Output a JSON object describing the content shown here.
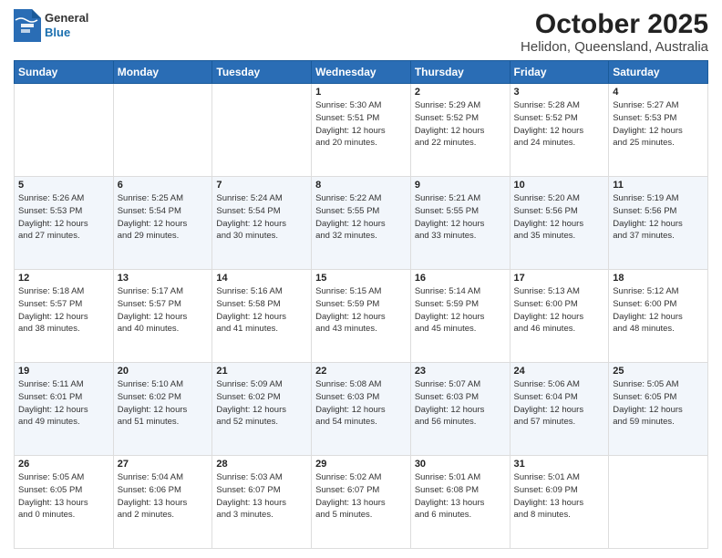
{
  "header": {
    "logo": {
      "line1": "General",
      "line2": "Blue"
    },
    "title": "October 2025",
    "subtitle": "Helidon, Queensland, Australia"
  },
  "calendar": {
    "days_of_week": [
      "Sunday",
      "Monday",
      "Tuesday",
      "Wednesday",
      "Thursday",
      "Friday",
      "Saturday"
    ],
    "weeks": [
      [
        {
          "day": "",
          "info": ""
        },
        {
          "day": "",
          "info": ""
        },
        {
          "day": "",
          "info": ""
        },
        {
          "day": "1",
          "info": "Sunrise: 5:30 AM\nSunset: 5:51 PM\nDaylight: 12 hours\nand 20 minutes."
        },
        {
          "day": "2",
          "info": "Sunrise: 5:29 AM\nSunset: 5:52 PM\nDaylight: 12 hours\nand 22 minutes."
        },
        {
          "day": "3",
          "info": "Sunrise: 5:28 AM\nSunset: 5:52 PM\nDaylight: 12 hours\nand 24 minutes."
        },
        {
          "day": "4",
          "info": "Sunrise: 5:27 AM\nSunset: 5:53 PM\nDaylight: 12 hours\nand 25 minutes."
        }
      ],
      [
        {
          "day": "5",
          "info": "Sunrise: 5:26 AM\nSunset: 5:53 PM\nDaylight: 12 hours\nand 27 minutes."
        },
        {
          "day": "6",
          "info": "Sunrise: 5:25 AM\nSunset: 5:54 PM\nDaylight: 12 hours\nand 29 minutes."
        },
        {
          "day": "7",
          "info": "Sunrise: 5:24 AM\nSunset: 5:54 PM\nDaylight: 12 hours\nand 30 minutes."
        },
        {
          "day": "8",
          "info": "Sunrise: 5:22 AM\nSunset: 5:55 PM\nDaylight: 12 hours\nand 32 minutes."
        },
        {
          "day": "9",
          "info": "Sunrise: 5:21 AM\nSunset: 5:55 PM\nDaylight: 12 hours\nand 33 minutes."
        },
        {
          "day": "10",
          "info": "Sunrise: 5:20 AM\nSunset: 5:56 PM\nDaylight: 12 hours\nand 35 minutes."
        },
        {
          "day": "11",
          "info": "Sunrise: 5:19 AM\nSunset: 5:56 PM\nDaylight: 12 hours\nand 37 minutes."
        }
      ],
      [
        {
          "day": "12",
          "info": "Sunrise: 5:18 AM\nSunset: 5:57 PM\nDaylight: 12 hours\nand 38 minutes."
        },
        {
          "day": "13",
          "info": "Sunrise: 5:17 AM\nSunset: 5:57 PM\nDaylight: 12 hours\nand 40 minutes."
        },
        {
          "day": "14",
          "info": "Sunrise: 5:16 AM\nSunset: 5:58 PM\nDaylight: 12 hours\nand 41 minutes."
        },
        {
          "day": "15",
          "info": "Sunrise: 5:15 AM\nSunset: 5:59 PM\nDaylight: 12 hours\nand 43 minutes."
        },
        {
          "day": "16",
          "info": "Sunrise: 5:14 AM\nSunset: 5:59 PM\nDaylight: 12 hours\nand 45 minutes."
        },
        {
          "day": "17",
          "info": "Sunrise: 5:13 AM\nSunset: 6:00 PM\nDaylight: 12 hours\nand 46 minutes."
        },
        {
          "day": "18",
          "info": "Sunrise: 5:12 AM\nSunset: 6:00 PM\nDaylight: 12 hours\nand 48 minutes."
        }
      ],
      [
        {
          "day": "19",
          "info": "Sunrise: 5:11 AM\nSunset: 6:01 PM\nDaylight: 12 hours\nand 49 minutes."
        },
        {
          "day": "20",
          "info": "Sunrise: 5:10 AM\nSunset: 6:02 PM\nDaylight: 12 hours\nand 51 minutes."
        },
        {
          "day": "21",
          "info": "Sunrise: 5:09 AM\nSunset: 6:02 PM\nDaylight: 12 hours\nand 52 minutes."
        },
        {
          "day": "22",
          "info": "Sunrise: 5:08 AM\nSunset: 6:03 PM\nDaylight: 12 hours\nand 54 minutes."
        },
        {
          "day": "23",
          "info": "Sunrise: 5:07 AM\nSunset: 6:03 PM\nDaylight: 12 hours\nand 56 minutes."
        },
        {
          "day": "24",
          "info": "Sunrise: 5:06 AM\nSunset: 6:04 PM\nDaylight: 12 hours\nand 57 minutes."
        },
        {
          "day": "25",
          "info": "Sunrise: 5:05 AM\nSunset: 6:05 PM\nDaylight: 12 hours\nand 59 minutes."
        }
      ],
      [
        {
          "day": "26",
          "info": "Sunrise: 5:05 AM\nSunset: 6:05 PM\nDaylight: 13 hours\nand 0 minutes."
        },
        {
          "day": "27",
          "info": "Sunrise: 5:04 AM\nSunset: 6:06 PM\nDaylight: 13 hours\nand 2 minutes."
        },
        {
          "day": "28",
          "info": "Sunrise: 5:03 AM\nSunset: 6:07 PM\nDaylight: 13 hours\nand 3 minutes."
        },
        {
          "day": "29",
          "info": "Sunrise: 5:02 AM\nSunset: 6:07 PM\nDaylight: 13 hours\nand 5 minutes."
        },
        {
          "day": "30",
          "info": "Sunrise: 5:01 AM\nSunset: 6:08 PM\nDaylight: 13 hours\nand 6 minutes."
        },
        {
          "day": "31",
          "info": "Sunrise: 5:01 AM\nSunset: 6:09 PM\nDaylight: 13 hours\nand 8 minutes."
        },
        {
          "day": "",
          "info": ""
        }
      ]
    ]
  }
}
